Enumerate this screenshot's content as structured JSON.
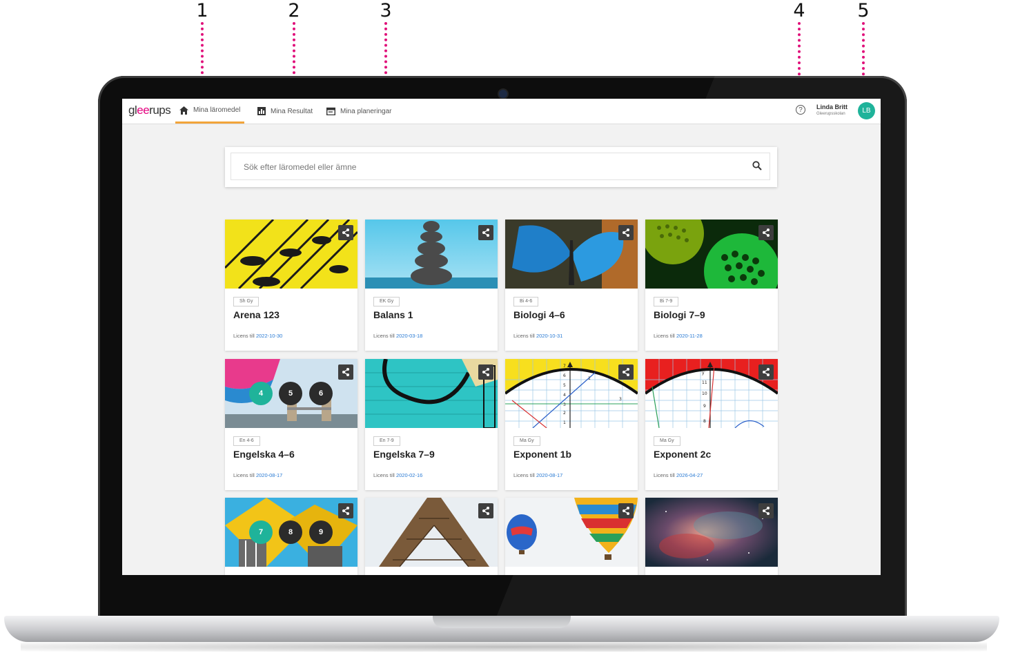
{
  "callouts": [
    "1",
    "2",
    "3",
    "4",
    "5"
  ],
  "header": {
    "logo": {
      "pre": "gl",
      "accent": "ee",
      "post": "rups"
    },
    "nav": [
      {
        "label": "Mina läromedel",
        "icon": "home-icon"
      },
      {
        "label": "Mina Resultat",
        "icon": "bar-chart-icon"
      },
      {
        "label": "Mina planeringar",
        "icon": "calendar-icon"
      }
    ],
    "help_symbol": "?",
    "user": {
      "name": "Linda Britt",
      "school": "Gleerupsskolan",
      "initials": "LB"
    }
  },
  "search": {
    "placeholder": "Sök efter läromedel eller ämne"
  },
  "colors": {
    "accent": "#e4007f",
    "nav_active": "#f2a43a",
    "avatar": "#1fb39a",
    "link": "#2a7bd4"
  },
  "license_prefix": "Licens till",
  "cards": [
    {
      "tag": "Sh Gy",
      "title": "Arena 123",
      "license_date": "2022-10-30"
    },
    {
      "tag": "EK Gy",
      "title": "Balans 1",
      "license_date": "2020-03-18"
    },
    {
      "tag": "Bi 4-6",
      "title": "Biologi 4–6",
      "license_date": "2020-10-31"
    },
    {
      "tag": "Bi 7-9",
      "title": "Biologi 7–9",
      "license_date": "2020-11-28"
    },
    {
      "tag": "En 4-6",
      "title": "Engelska 4–6",
      "license_date": "2020-08-17"
    },
    {
      "tag": "En 7-9",
      "title": "Engelska 7–9",
      "license_date": "2020-02-16"
    },
    {
      "tag": "Ma Gy",
      "title": "Exponent 1b",
      "license_date": "2020-08-17"
    },
    {
      "tag": "Ma Gy",
      "title": "Exponent 2c",
      "license_date": "2026-04-27"
    }
  ],
  "badges_row2": [
    "4",
    "5",
    "6"
  ],
  "badges_row3": [
    "7",
    "8",
    "9"
  ],
  "graph_labels": {
    "c7": [
      "7",
      "6",
      "5",
      "4",
      "3",
      "2",
      "1",
      "1",
      "3"
    ],
    "c8": [
      "y",
      "11",
      "10",
      "9",
      "8"
    ]
  }
}
